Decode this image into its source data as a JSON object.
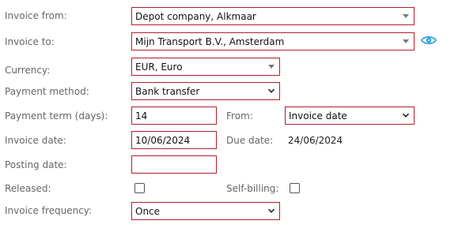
{
  "labels": {
    "invoice_from": "Invoice from:",
    "invoice_to": "Invoice to:",
    "currency": "Currency:",
    "payment_method": "Payment method:",
    "payment_term": "Payment term (days):",
    "from": "From:",
    "invoice_date": "Invoice date:",
    "due_date": "Due date:",
    "posting_date": "Posting date:",
    "released": "Released:",
    "self_billing": "Self-billing:",
    "invoice_frequency": "Invoice frequency:"
  },
  "values": {
    "invoice_from": "Depot company, Alkmaar",
    "invoice_to": "Mijn Transport B.V., Amsterdam",
    "currency": "EUR, Euro",
    "payment_method": "Bank transfer",
    "payment_term": "14",
    "from": "Invoice date",
    "invoice_date": "10/06/2024",
    "due_date": "24/06/2024",
    "posting_date": "",
    "released": false,
    "self_billing": false,
    "invoice_frequency": "Once"
  },
  "icons": {
    "view": "eye-icon",
    "dropdown": "triangle-down-icon",
    "select": "chevron-down-icon"
  },
  "colors": {
    "field_border": "#b0202a",
    "eye_icon": "#2a9fd6",
    "label_text": "#666666"
  }
}
